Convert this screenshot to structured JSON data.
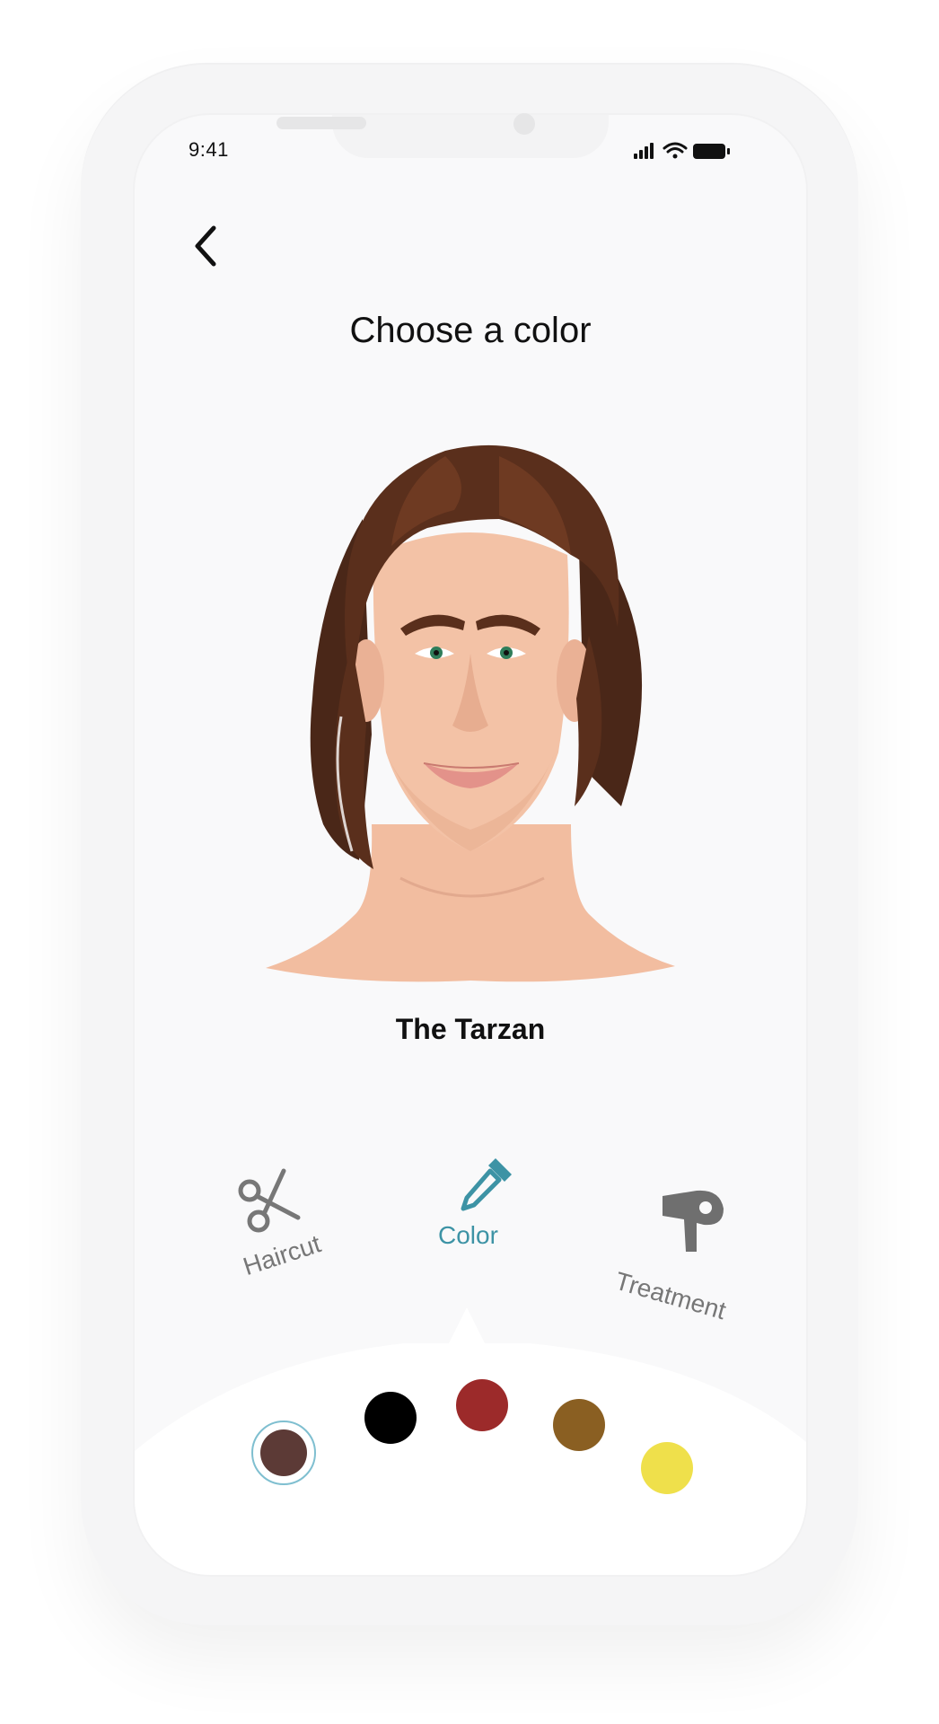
{
  "status_bar": {
    "time": "9:41"
  },
  "header": {
    "title": "Choose a color"
  },
  "avatar": {
    "style_name": "The Tarzan"
  },
  "tabs": [
    {
      "label": "Haircut",
      "icon": "scissors-icon",
      "active": false
    },
    {
      "label": "Color",
      "icon": "eyedropper-icon",
      "active": true
    },
    {
      "label": "Treatment",
      "icon": "hair-dryer-icon",
      "active": false
    }
  ],
  "colors": {
    "accent": "#3d93a5",
    "inactive": "#777777",
    "swatches": [
      "#5c3a36",
      "#000000",
      "#9c2a2a",
      "#8a5f22",
      "#efe04b"
    ],
    "selected_swatch": 0
  }
}
